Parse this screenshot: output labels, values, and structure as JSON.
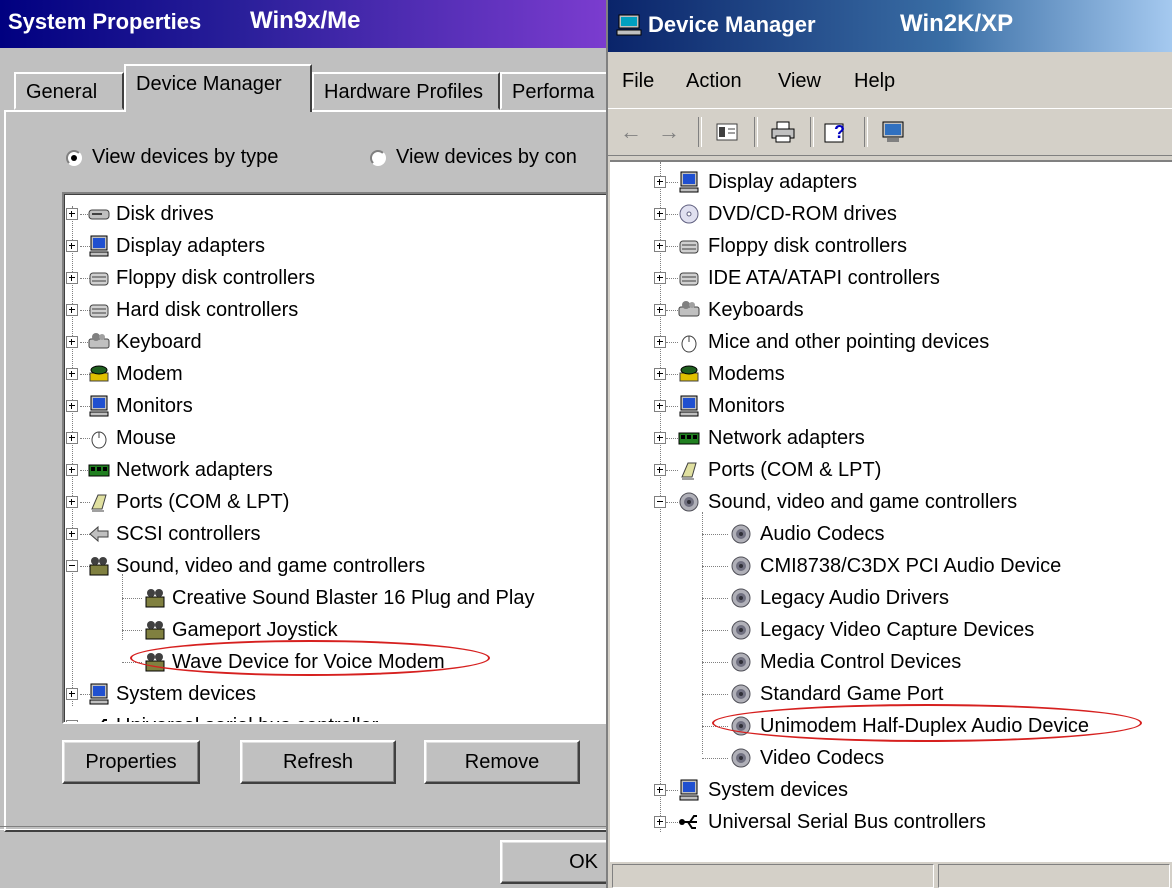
{
  "left_window": {
    "title": "System Properties",
    "title_tag": "Win9x/Me",
    "tabs": [
      "General",
      "Device Manager",
      "Hardware Profiles",
      "Performa"
    ],
    "active_tab": "Device Manager",
    "radio_by_type": "View devices by type",
    "radio_by_connection": "View devices by con",
    "tree": [
      {
        "label": "Disk drives",
        "icon": "disk-drive-icon",
        "expander": "plus"
      },
      {
        "label": "Display adapters",
        "icon": "monitor-icon",
        "expander": "plus"
      },
      {
        "label": "Floppy disk controllers",
        "icon": "controller-icon",
        "expander": "plus"
      },
      {
        "label": "Hard disk controllers",
        "icon": "controller-icon",
        "expander": "plus"
      },
      {
        "label": "Keyboard",
        "icon": "keyboard-icon",
        "expander": "plus"
      },
      {
        "label": "Modem",
        "icon": "modem-icon",
        "expander": "plus"
      },
      {
        "label": "Monitors",
        "icon": "monitor-icon",
        "expander": "plus"
      },
      {
        "label": "Mouse",
        "icon": "mouse-icon",
        "expander": "plus"
      },
      {
        "label": "Network adapters",
        "icon": "network-card-icon",
        "expander": "plus"
      },
      {
        "label": "Ports (COM & LPT)",
        "icon": "port-icon",
        "expander": "plus"
      },
      {
        "label": "SCSI controllers",
        "icon": "scsi-icon",
        "expander": "plus"
      },
      {
        "label": "Sound, video and game controllers",
        "icon": "sound-icon",
        "expander": "minus"
      },
      {
        "label": "Creative Sound Blaster 16 Plug and Play",
        "icon": "sound-icon",
        "child": true
      },
      {
        "label": "Gameport Joystick",
        "icon": "sound-icon",
        "child": true
      },
      {
        "label": "Wave Device for Voice Modem",
        "icon": "sound-icon",
        "child": true,
        "highlighted": true
      },
      {
        "label": "System devices",
        "icon": "monitor-icon",
        "expander": "plus"
      },
      {
        "label": "Universal serial bus controller",
        "icon": "usb-icon",
        "expander": "plus",
        "clipped": true
      }
    ],
    "buttons": {
      "properties": "Properties",
      "refresh": "Refresh",
      "remove": "Remove",
      "ok": "OK"
    }
  },
  "right_window": {
    "title": "Device Manager",
    "title_tag": "Win2K/XP",
    "menu": [
      "File",
      "Action",
      "View",
      "Help"
    ],
    "toolbar": [
      "back-arrow-icon",
      "forward-arrow-icon",
      "properties-icon",
      "print-icon",
      "help-icon",
      "scan-icon"
    ],
    "tree": [
      {
        "label": "Display adapters",
        "icon": "monitor-icon",
        "expander": "plus"
      },
      {
        "label": "DVD/CD-ROM drives",
        "icon": "cdrom-icon",
        "expander": "plus"
      },
      {
        "label": "Floppy disk controllers",
        "icon": "controller-icon",
        "expander": "plus"
      },
      {
        "label": "IDE ATA/ATAPI controllers",
        "icon": "controller-icon",
        "expander": "plus"
      },
      {
        "label": "Keyboards",
        "icon": "keyboard-icon",
        "expander": "plus"
      },
      {
        "label": "Mice and other pointing devices",
        "icon": "mouse-icon",
        "expander": "plus"
      },
      {
        "label": "Modems",
        "icon": "modem-icon",
        "expander": "plus"
      },
      {
        "label": "Monitors",
        "icon": "monitor-icon",
        "expander": "plus"
      },
      {
        "label": "Network adapters",
        "icon": "network-card-icon",
        "expander": "plus"
      },
      {
        "label": "Ports (COM & LPT)",
        "icon": "port-icon",
        "expander": "plus"
      },
      {
        "label": "Sound, video and game controllers",
        "icon": "speaker-icon",
        "expander": "minus"
      },
      {
        "label": "Audio Codecs",
        "icon": "speaker-icon",
        "child": true
      },
      {
        "label": "CMI8738/C3DX PCI Audio Device",
        "icon": "speaker-icon",
        "child": true
      },
      {
        "label": "Legacy Audio Drivers",
        "icon": "speaker-icon",
        "child": true
      },
      {
        "label": "Legacy Video Capture Devices",
        "icon": "speaker-icon",
        "child": true
      },
      {
        "label": "Media Control Devices",
        "icon": "speaker-icon",
        "child": true
      },
      {
        "label": "Standard Game Port",
        "icon": "speaker-icon",
        "child": true
      },
      {
        "label": "Unimodem Half-Duplex Audio Device",
        "icon": "speaker-icon",
        "child": true,
        "highlighted": true
      },
      {
        "label": "Video Codecs",
        "icon": "speaker-icon",
        "child": true
      },
      {
        "label": "System devices",
        "icon": "monitor-icon",
        "expander": "plus"
      },
      {
        "label": "Universal Serial Bus controllers",
        "icon": "usb-icon",
        "expander": "plus"
      }
    ]
  },
  "colors": {
    "highlight_ellipse": "#d6201f",
    "win9x_title": "#000080",
    "win2k_title": "#0a246a"
  }
}
